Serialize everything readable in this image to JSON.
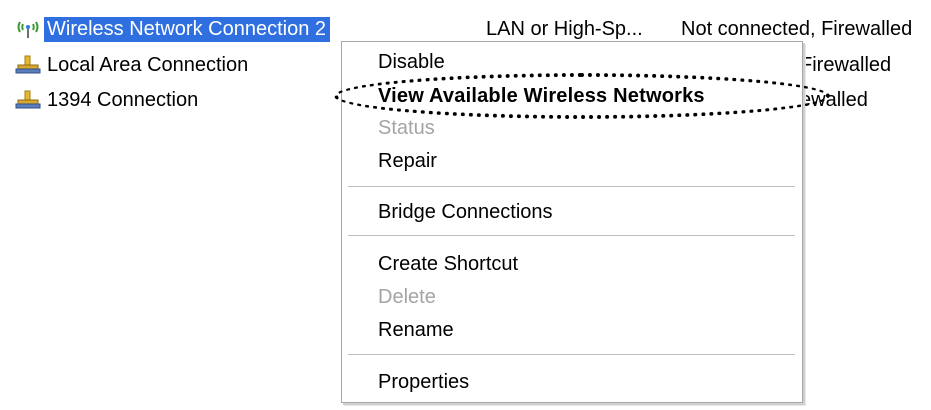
{
  "connections": [
    {
      "name": "Wireless Network Connection 2",
      "type": "LAN or High-Sp...",
      "status": "Not connected, Firewalled",
      "selected": true,
      "icon": "wireless-network-icon"
    },
    {
      "name": "Local Area Connection",
      "status_partial": "Firewalled",
      "icon": "network-connection-icon"
    },
    {
      "name": "1394 Connection",
      "status_partial": "ewalled",
      "icon": "network-connection-icon"
    }
  ],
  "context_menu": {
    "items": [
      {
        "label": "Disable",
        "enabled": true
      },
      {
        "label": "View Available Wireless Networks",
        "enabled": true,
        "bold": true,
        "highlighted": true
      },
      {
        "label": "Status",
        "enabled": false
      },
      {
        "label": "Repair",
        "enabled": true
      },
      {
        "label": "Bridge Connections",
        "enabled": true
      },
      {
        "label": "Create Shortcut",
        "enabled": true
      },
      {
        "label": "Delete",
        "enabled": false
      },
      {
        "label": "Rename",
        "enabled": true
      },
      {
        "label": "Properties",
        "enabled": true
      }
    ]
  },
  "colors": {
    "selection": "#2f6fe0",
    "disabled_text": "#a4a4a4",
    "menu_border": "#a7a7a7"
  }
}
